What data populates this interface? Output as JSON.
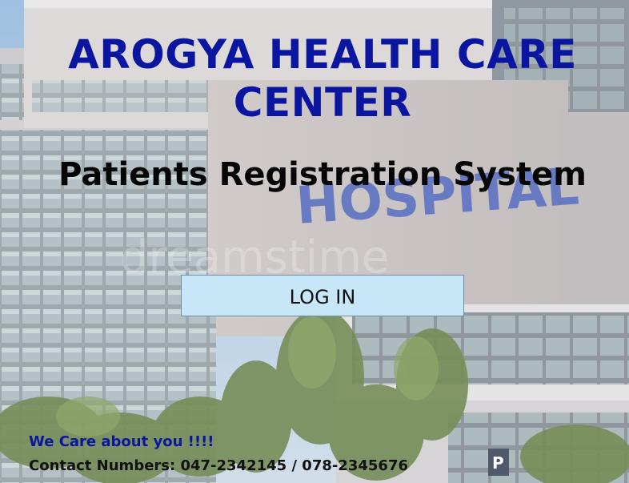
{
  "header": {
    "title": "AROGYA HEALTH CARE CENTER",
    "subtitle": "Patients Registration System"
  },
  "actions": {
    "login_label": "LOG IN"
  },
  "footer": {
    "tagline": "We Care about you !!!!",
    "contact": "Contact Numbers: 047-2342145 / 078-2345676"
  },
  "background": {
    "building_sign": "HOSPITAL",
    "watermark": "dreamstime"
  },
  "colors": {
    "title": "#0a16a0",
    "subtitle": "#050505",
    "button_bg": "#c7e6f8",
    "tagline": "#0a16a0"
  }
}
